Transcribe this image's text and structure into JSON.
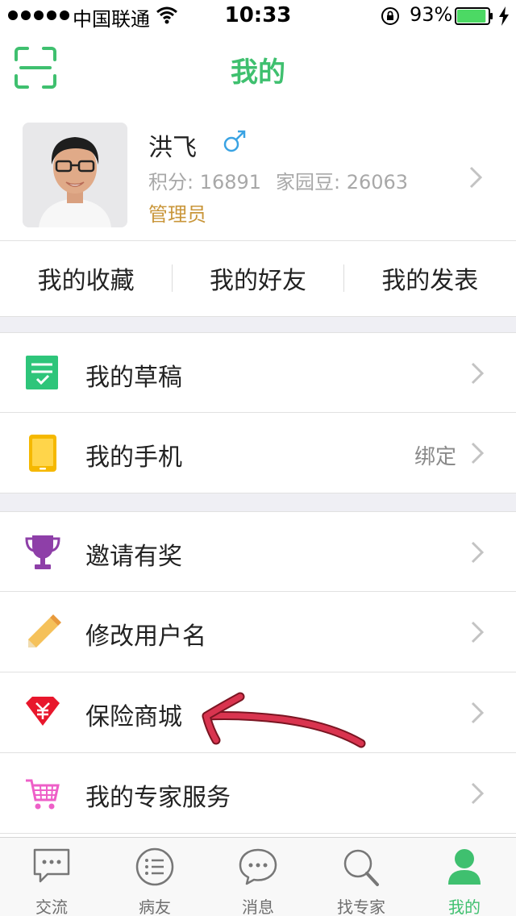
{
  "status_bar": {
    "carrier": "中国联通",
    "time": "10:33",
    "battery": "93%",
    "battery_level": 0.93
  },
  "nav": {
    "title": "我的",
    "scan_icon": "scan-icon"
  },
  "profile": {
    "name": "洪飞",
    "gender_symbol": "♂",
    "points": "积分: 16891",
    "beans": "家园豆: 26063",
    "role": "管理员"
  },
  "shortcuts": [
    "我的收藏",
    "我的好友",
    "我的发表"
  ],
  "menu": {
    "drafts": {
      "label": "我的草稿",
      "icon": "draft-icon"
    },
    "phone": {
      "label": "我的手机",
      "extra": "绑定",
      "icon": "phone-icon"
    },
    "invite": {
      "label": "邀请有奖",
      "icon": "trophy-icon"
    },
    "rename": {
      "label": "修改用户名",
      "icon": "pencil-icon"
    },
    "insurance": {
      "label": "保险商城",
      "icon": "diamond-yen-icon"
    },
    "expert": {
      "label": "我的专家服务",
      "icon": "cart-icon"
    }
  },
  "tabs": [
    {
      "label": "交流",
      "icon": "chat-bubble-icon"
    },
    {
      "label": "病友",
      "icon": "list-icon"
    },
    {
      "label": "消息",
      "icon": "message-icon"
    },
    {
      "label": "找专家",
      "icon": "search-icon"
    },
    {
      "label": "我的",
      "icon": "person-icon",
      "active": true
    }
  ],
  "colors": {
    "accent": "#3fc06f",
    "role": "#c9963a",
    "annotation": "#d9344f"
  }
}
